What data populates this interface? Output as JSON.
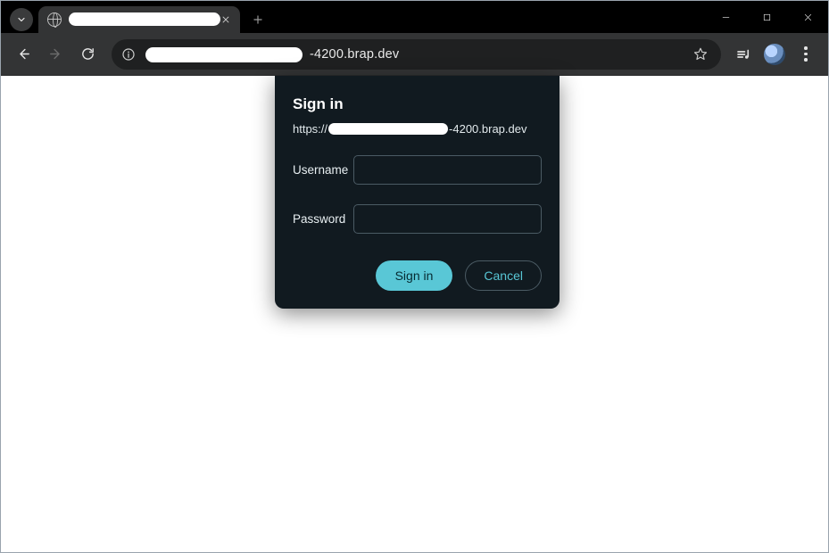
{
  "browser": {
    "tab_title_masked": true,
    "url_visible_suffix": "-4200.brap.dev"
  },
  "dialog": {
    "title": "Sign in",
    "host_prefix": "https://",
    "host_suffix": "-4200.brap.dev",
    "labels": {
      "username": "Username",
      "password": "Password"
    },
    "buttons": {
      "signin": "Sign in",
      "cancel": "Cancel"
    },
    "values": {
      "username": "",
      "password": ""
    }
  }
}
